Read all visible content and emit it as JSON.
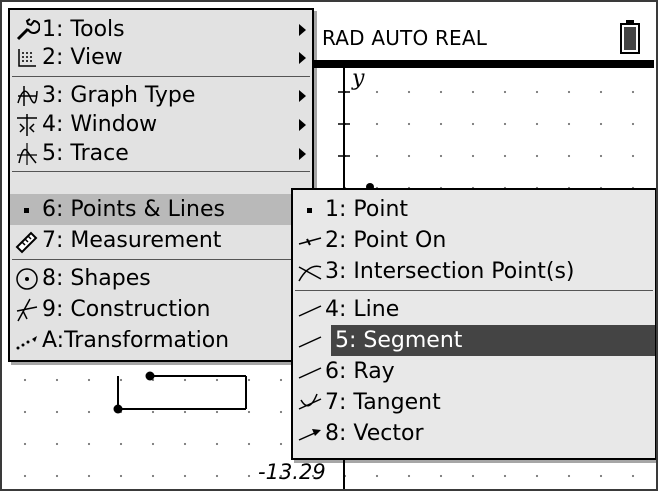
{
  "status": {
    "mode": "RAD AUTO REAL",
    "battery_icon": "battery-icon"
  },
  "graph": {
    "y_axis_label": "y",
    "measurement": "-13.29"
  },
  "main_menu": {
    "items": [
      {
        "label": "1: Tools",
        "icon": "wrench-icon",
        "has_submenu": true
      },
      {
        "label": "2: View",
        "icon": "grid-view-icon",
        "has_submenu": true
      },
      {
        "label": "3: Graph Type",
        "icon": "graph-type-icon",
        "has_submenu": true
      },
      {
        "label": "4: Window",
        "icon": "window-zoom-icon",
        "has_submenu": true
      },
      {
        "label": "5: Trace",
        "icon": "trace-icon",
        "has_submenu": true
      },
      {
        "label": "6: Points & Lines",
        "icon": "point-icon",
        "has_submenu": true,
        "highlighted": true
      },
      {
        "label": "7: Measurement",
        "icon": "ruler-icon",
        "has_submenu": true
      },
      {
        "label": "8: Shapes",
        "icon": "circle-shape-icon",
        "has_submenu": true
      },
      {
        "label": "9: Construction",
        "icon": "construction-icon",
        "has_submenu": true
      },
      {
        "label": "A:Transformation",
        "icon": "transformation-icon",
        "has_submenu": true
      }
    ]
  },
  "sub_menu": {
    "items": [
      {
        "label": "1: Point",
        "icon": "point-icon"
      },
      {
        "label": "2: Point On",
        "icon": "point-on-icon"
      },
      {
        "label": "3: Intersection Point(s)",
        "icon": "intersection-icon"
      },
      {
        "label": "4: Line",
        "icon": "line-icon"
      },
      {
        "label": "5: Segment",
        "icon": "segment-icon",
        "selected": true
      },
      {
        "label": "6: Ray",
        "icon": "ray-icon"
      },
      {
        "label": "7: Tangent",
        "icon": "tangent-icon"
      },
      {
        "label": "8: Vector",
        "icon": "vector-icon"
      }
    ]
  },
  "colors": {
    "menu_bg": "#e2e2e2",
    "highlight": "#b9b9b9",
    "selected": "#444444",
    "selected_text": "#ffffff"
  }
}
